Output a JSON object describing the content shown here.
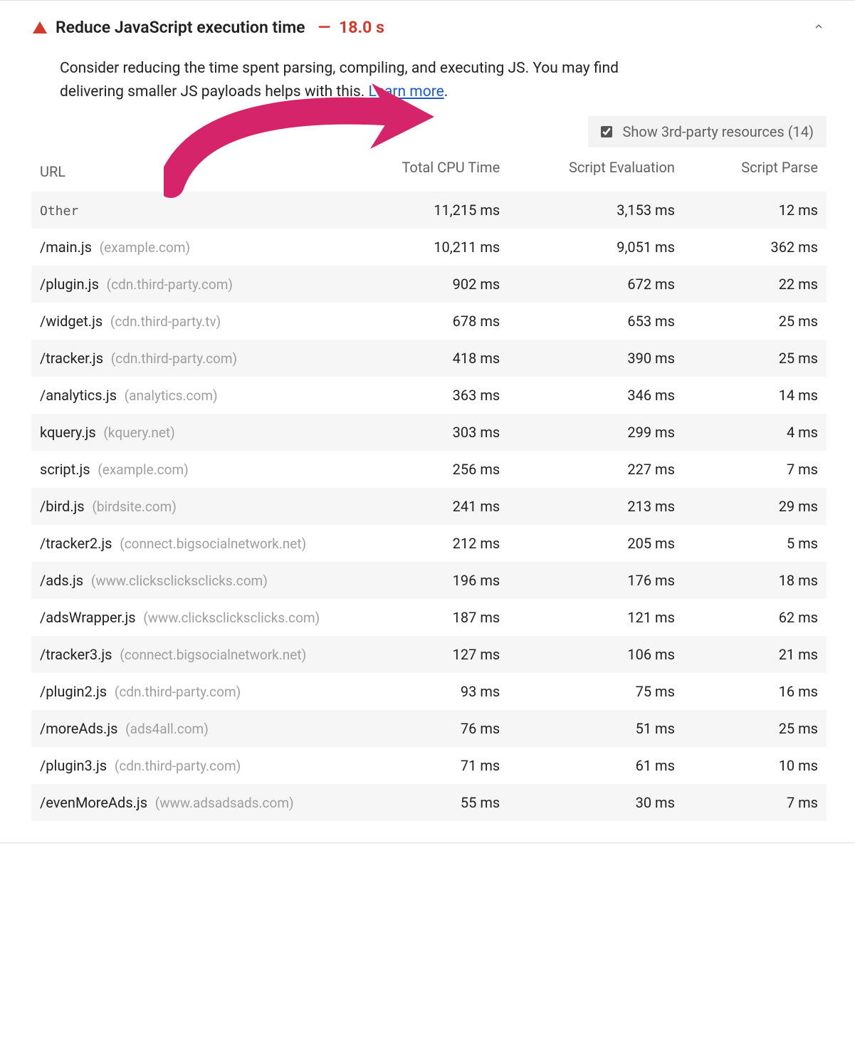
{
  "audit": {
    "title": "Reduce JavaScript execution time",
    "dash": "—",
    "timing": "18.0 s",
    "description_pre": "Consider reducing the time spent parsing, compiling, and executing JS. You may find delivering smaller JS payloads helps with this. ",
    "learn_more": "Learn more",
    "description_post": "."
  },
  "toggle": {
    "label": "Show 3rd-party resources (14)",
    "checked": true
  },
  "columns": {
    "url": "URL",
    "cpu": "Total CPU Time",
    "eval": "Script Evaluation",
    "parse": "Script Parse"
  },
  "rows": [
    {
      "path": "Other",
      "host": "",
      "mono": true,
      "cpu": "11,215 ms",
      "eval": "3,153 ms",
      "parse": "12 ms"
    },
    {
      "path": "/main.js",
      "host": "(example.com)",
      "cpu": "10,211 ms",
      "eval": "9,051 ms",
      "parse": "362 ms"
    },
    {
      "path": "/plugin.js",
      "host": "(cdn.third-party.com)",
      "cpu": "902 ms",
      "eval": "672 ms",
      "parse": "22 ms"
    },
    {
      "path": "/widget.js",
      "host": "(cdn.third-party.tv)",
      "cpu": "678 ms",
      "eval": "653 ms",
      "parse": "25 ms"
    },
    {
      "path": "/tracker.js",
      "host": "(cdn.third-party.com)",
      "cpu": "418 ms",
      "eval": "390 ms",
      "parse": "25 ms"
    },
    {
      "path": "/analytics.js",
      "host": "(analytics.com)",
      "cpu": "363 ms",
      "eval": "346 ms",
      "parse": "14 ms"
    },
    {
      "path": "kquery.js",
      "host": "(kquery.net)",
      "cpu": "303 ms",
      "eval": "299 ms",
      "parse": "4 ms"
    },
    {
      "path": "script.js",
      "host": "(example.com)",
      "cpu": "256 ms",
      "eval": "227 ms",
      "parse": "7 ms"
    },
    {
      "path": "/bird.js",
      "host": "(birdsite.com)",
      "cpu": "241 ms",
      "eval": "213 ms",
      "parse": "29 ms"
    },
    {
      "path": "/tracker2.js",
      "host": "(connect.bigsocialnetwork.net)",
      "cpu": "212 ms",
      "eval": "205 ms",
      "parse": "5 ms"
    },
    {
      "path": "/ads.js",
      "host": "(www.clicksclicksclicks.com)",
      "cpu": "196 ms",
      "eval": "176 ms",
      "parse": "18 ms"
    },
    {
      "path": "/adsWrapper.js",
      "host": "(www.clicksclicksclicks.com)",
      "cpu": "187 ms",
      "eval": "121 ms",
      "parse": "62 ms"
    },
    {
      "path": "/tracker3.js",
      "host": "(connect.bigsocialnetwork.net)",
      "cpu": "127 ms",
      "eval": "106 ms",
      "parse": "21 ms"
    },
    {
      "path": "/plugin2.js",
      "host": "(cdn.third-party.com)",
      "cpu": "93 ms",
      "eval": "75 ms",
      "parse": "16 ms"
    },
    {
      "path": "/moreAds.js",
      "host": "(ads4all.com)",
      "cpu": "76 ms",
      "eval": "51 ms",
      "parse": "25 ms"
    },
    {
      "path": "/plugin3.js",
      "host": "(cdn.third-party.com)",
      "cpu": "71 ms",
      "eval": "61 ms",
      "parse": "10 ms"
    },
    {
      "path": "/evenMoreAds.js",
      "host": "(www.adsadsads.com)",
      "cpu": "55 ms",
      "eval": "30 ms",
      "parse": "7 ms"
    }
  ],
  "annotation": {
    "arrow_color": "#d6246b"
  }
}
